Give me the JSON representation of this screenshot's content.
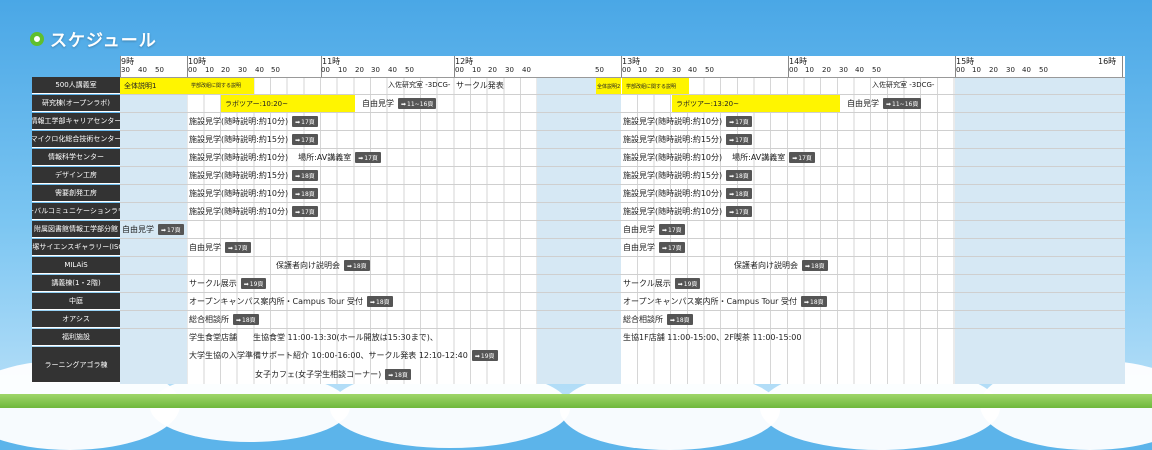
{
  "title": "スケジュール",
  "accent_green": "#5fbf2e",
  "highlight_yellow": "#fff500",
  "header": {
    "hours": [
      "9時",
      "10時",
      "11時",
      "12時",
      "13時",
      "14時",
      "15時",
      "16時"
    ],
    "min_9": [
      "30",
      "40",
      "50"
    ],
    "mins": [
      "00",
      "10",
      "20",
      "30",
      "40",
      "50"
    ],
    "min_12": [
      "00",
      "10",
      "20",
      "30",
      "40"
    ],
    "min_12_50": "50"
  },
  "rows": [
    "500人講義室",
    "研究棟(オープンラボ)",
    "情報工学部キャリアセンター",
    "マイクロ化総合技術センター",
    "情報科学センター",
    "デザイン工房",
    "需要創発工房",
    "グローバルコミュニケーションラウンジ",
    "附属図書館情報工学部分館",
    "飯塚サイエンスギャラリー(ISG)",
    "MILAiS",
    "講義棟(1・2階)",
    "中庭",
    "オアシス",
    "福利施設",
    "ラーニングアゴラ棟"
  ],
  "ev": {
    "zentai1": "全体説明1",
    "kaiso1": "学部改組に関する説明",
    "kenkyu1": "入佐研究室 -3DCG-",
    "circle": "サークル発表",
    "zentai2": "全体説明2",
    "kaiso2": "学部改組に関する説明",
    "kenkyu2": "入佐研究室 -3DCG-",
    "lab1": "ラボツアー:10:20~",
    "lab2": "ラボツアー:13:20~",
    "jiyu": "自由見学",
    "p11_16": "11~16頁",
    "shisetsu10": "施設見学(随時説明:約10分)",
    "shisetsu15": "施設見学(随時説明:約15分)",
    "av": "場所:AV講義室",
    "p17": "17頁",
    "p18": "18頁",
    "p19": "19頁",
    "hogosha": "保護者向け説明会",
    "circle_ten": "サークル展示",
    "annai": "オープンキャンパス案内所・Campus Tour 受付",
    "sogo": "総合相談所",
    "shokudo": "学生食堂店舗　　生協食堂 11:00-13:30(ホール開放は15:30まで)、",
    "seikyo": "生協1F店舗 11:00-15:00、2F喫茶 11:00-15:00",
    "seikyo_agora": "大学生協の入学準備サポート紹介 10:00-16:00、サークル発表 12:10-12:40",
    "cafe": "女子カフェ(女子学生相談コーナー)"
  }
}
